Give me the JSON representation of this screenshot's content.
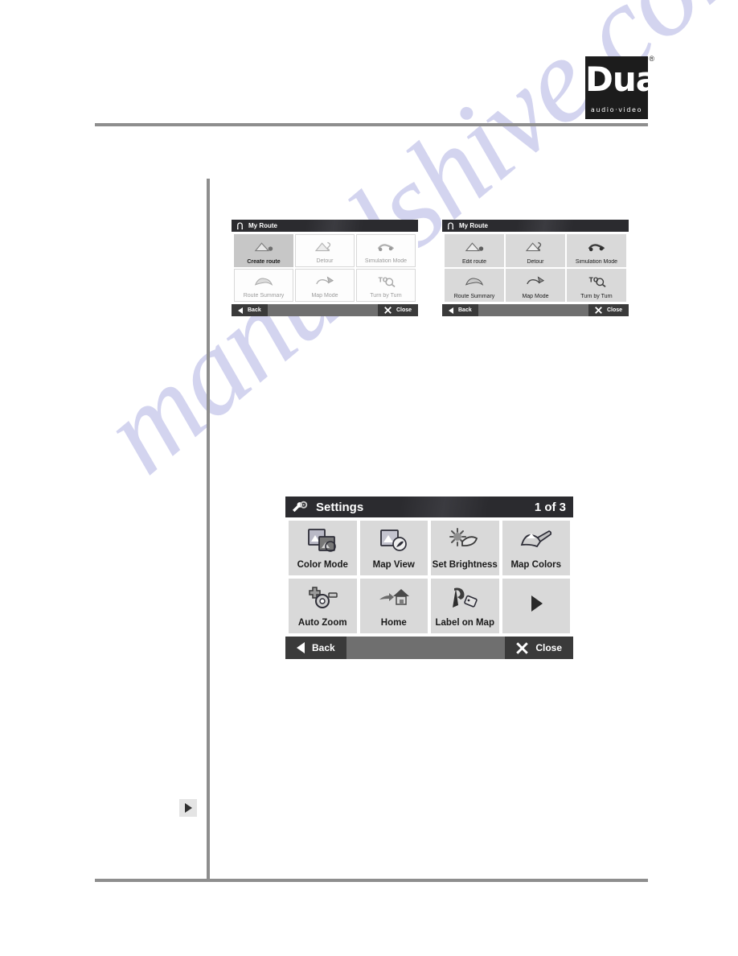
{
  "brand": {
    "logo_word": "Dual",
    "logo_tagline": "audio·video",
    "trademark": "®"
  },
  "watermark": {
    "text": "manualshive.com"
  },
  "dialogs": [
    {
      "id": "my-route-1",
      "title": "My Route",
      "title_icon": "route-horseshoe-icon",
      "page_indicator": "",
      "tiles": [
        {
          "label": "Create route",
          "icon": "create-route-icon",
          "state": "active"
        },
        {
          "label": "Detour",
          "icon": "detour-icon",
          "state": "disabled"
        },
        {
          "label": "Simulation Mode",
          "icon": "simulation-mode-icon",
          "state": "disabled"
        },
        {
          "label": "Route Summary",
          "icon": "route-summary-icon",
          "state": "disabled"
        },
        {
          "label": "Map Mode",
          "icon": "map-mode-icon",
          "state": "disabled"
        },
        {
          "label": "Turn by Turn",
          "icon": "turn-by-turn-icon",
          "state": "disabled"
        }
      ],
      "footer": {
        "back_label": "Back",
        "close_label": "Close"
      }
    },
    {
      "id": "my-route-2",
      "title": "My Route",
      "title_icon": "route-horseshoe-icon",
      "page_indicator": "",
      "tiles": [
        {
          "label": "Edit route",
          "icon": "edit-route-icon",
          "state": "enabled"
        },
        {
          "label": "Detour",
          "icon": "detour-icon",
          "state": "enabled"
        },
        {
          "label": "Simulation Mode",
          "icon": "simulation-mode-icon",
          "state": "enabled"
        },
        {
          "label": "Route Summary",
          "icon": "route-summary-icon",
          "state": "enabled"
        },
        {
          "label": "Map Mode",
          "icon": "map-mode-icon",
          "state": "enabled"
        },
        {
          "label": "Turn by Turn",
          "icon": "turn-by-turn-icon",
          "state": "enabled"
        }
      ],
      "footer": {
        "back_label": "Back",
        "close_label": "Close"
      }
    },
    {
      "id": "settings",
      "title": "Settings",
      "title_icon": "wrench-gear-icon",
      "page_indicator": "1 of 3",
      "tiles": [
        {
          "label": "Color Mode",
          "icon": "color-mode-icon",
          "state": "enabled"
        },
        {
          "label": "Map View",
          "icon": "map-view-icon",
          "state": "enabled"
        },
        {
          "label": "Set Brightness",
          "icon": "set-brightness-icon",
          "state": "enabled"
        },
        {
          "label": "Map Colors",
          "icon": "map-colors-icon",
          "state": "enabled"
        },
        {
          "label": "Auto Zoom",
          "icon": "auto-zoom-icon",
          "state": "enabled"
        },
        {
          "label": "Home",
          "icon": "home-icon",
          "state": "enabled"
        },
        {
          "label": "Label on Map",
          "icon": "label-on-map-icon",
          "state": "enabled"
        },
        {
          "label": "",
          "icon": "next-page-arrow-icon",
          "state": "enabled"
        }
      ],
      "footer": {
        "back_label": "Back",
        "close_label": "Close"
      }
    }
  ],
  "page_nav": {
    "next_icon": "next-arrow-icon"
  },
  "colors": {
    "title_bar": "#2b2b2f",
    "footer_bar": "#6f6f6f",
    "footer_button": "#3a3a3a",
    "tile": "#d9d9d9",
    "tile_active": "#c7c7c7",
    "rule": "#8e8e8e",
    "watermark": "#b9bbe6"
  }
}
